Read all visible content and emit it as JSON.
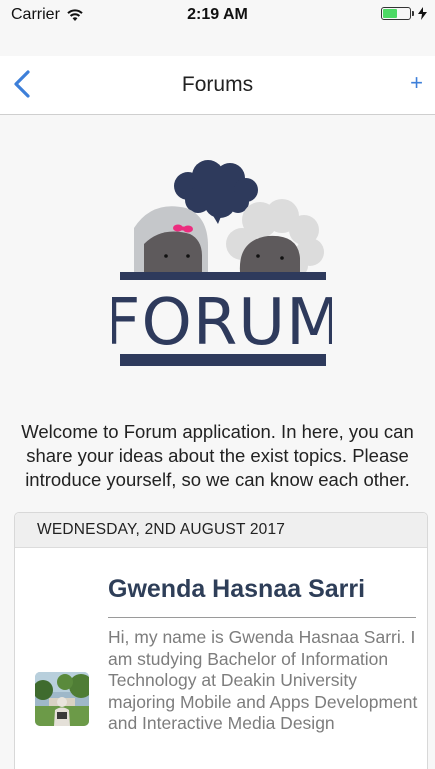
{
  "status_bar": {
    "carrier": "Carrier",
    "time": "2:19 AM",
    "battery_level": 0.55,
    "battery_color": "#4cd964"
  },
  "nav": {
    "back_icon": "chevron-left-icon",
    "title": "Forums",
    "add_label": "+",
    "accent_color": "#3d7fd9"
  },
  "logo": {
    "text": "FORUM",
    "color": "#2e3a5c"
  },
  "welcome_text": "Welcome to Forum application. In here, you can share your ideas about the exist topics. Please introduce yourself, so we can know each other.",
  "post": {
    "date": "WEDNESDAY, 2ND AUGUST 2017",
    "author": "Gwenda Hasnaa Sarri",
    "body": "Hi, my name is Gwenda Hasnaa Sarri. I am studying Bachelor of Information Technology at Deakin University majoring Mobile and Apps Development and Interactive Media Design"
  }
}
